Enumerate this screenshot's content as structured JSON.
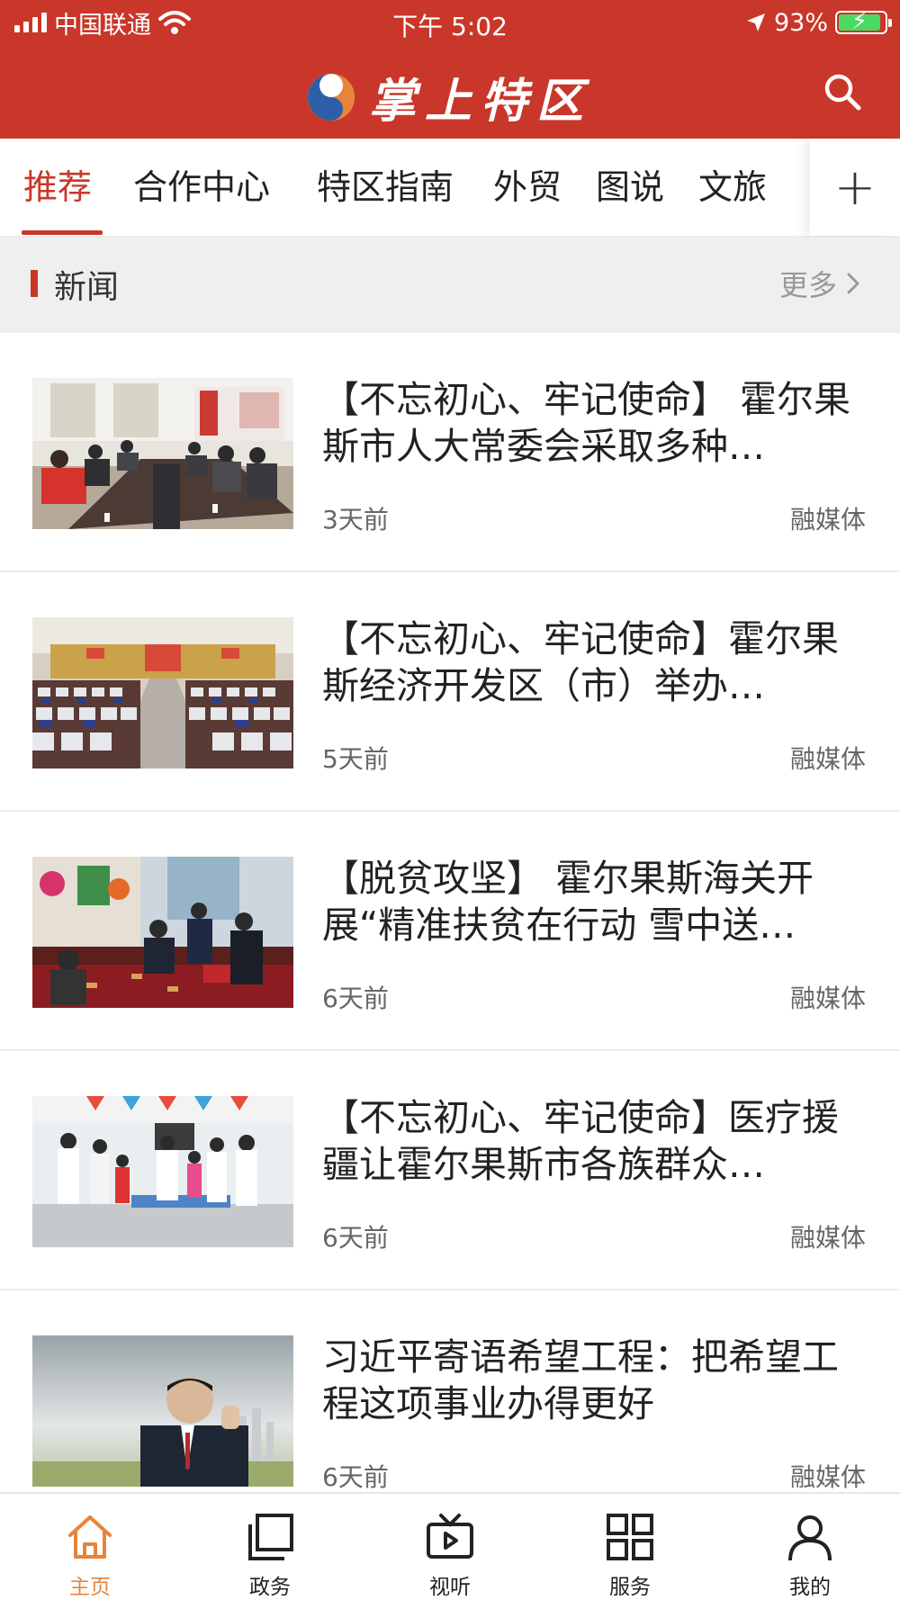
{
  "status_bar": {
    "carrier": "中国联通",
    "time": "下午 5:02",
    "battery": "93%",
    "battery_level": 0.93
  },
  "header": {
    "app_title": "掌上特区",
    "search_icon": "search-icon"
  },
  "tabs": [
    {
      "label": "推荐",
      "active": true
    },
    {
      "label": "合作中心",
      "active": false
    },
    {
      "label": "特区指南",
      "active": false
    },
    {
      "label": "外贸",
      "active": false
    },
    {
      "label": "图说",
      "active": false
    },
    {
      "label": "文旅",
      "active": false
    }
  ],
  "tab_add_label": "+",
  "section": {
    "title": "新闻",
    "more_label": "更多"
  },
  "news": [
    {
      "title": "【不忘初心、牢记使命】 霍尔果斯市人大常委会采取多种…",
      "time": "3天前",
      "source": "融媒体"
    },
    {
      "title": "【不忘初心、牢记使命】霍尔果斯经济开发区（市）举办…",
      "time": "5天前",
      "source": "融媒体"
    },
    {
      "title": "【脱贫攻坚】 霍尔果斯海关开展“精准扶贫在行动 雪中送…",
      "time": "6天前",
      "source": "融媒体"
    },
    {
      "title": "【不忘初心、牢记使命】医疗援疆让霍尔果斯市各族群众…",
      "time": "6天前",
      "source": "融媒体"
    },
    {
      "title": "习近平寄语希望工程：把希望工程这项事业办得更好",
      "time": "6天前",
      "source": "融媒体"
    }
  ],
  "bottom_nav": [
    {
      "label": "主页",
      "icon": "home-icon",
      "active": true
    },
    {
      "label": "政务",
      "icon": "layers-icon",
      "active": false
    },
    {
      "label": "视听",
      "icon": "tv-play-icon",
      "active": false
    },
    {
      "label": "服务",
      "icon": "grid-icon",
      "active": false
    },
    {
      "label": "我的",
      "icon": "user-icon",
      "active": false
    }
  ],
  "colors": {
    "brand": "#c9372a",
    "nav_active": "#e8833a"
  }
}
